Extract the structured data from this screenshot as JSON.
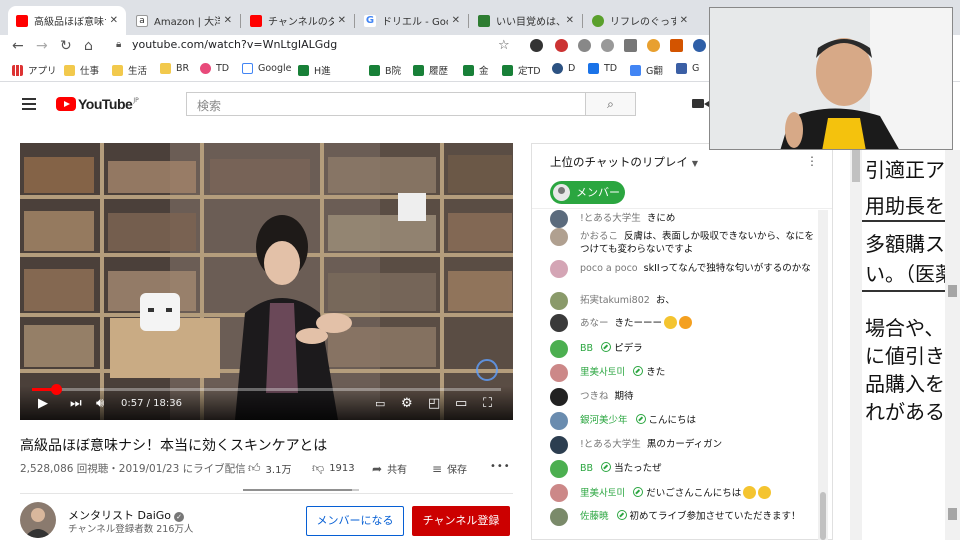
{
  "browser": {
    "tabs": [
      {
        "title": "高級品ほぼ意味ナシ",
        "favicon": "youtube-icon",
        "color": "#ff0000",
        "active": true
      },
      {
        "title": "Amazon | 大洋製",
        "favicon": "amazon-icon",
        "color": "#222222"
      },
      {
        "title": "チャンネルのダッシュ",
        "favicon": "youtube-icon",
        "color": "#ff0000"
      },
      {
        "title": "ドリエル - Google",
        "favicon": "google-icon",
        "color": "#4285f4"
      },
      {
        "title": "いい目覚めは、いい",
        "favicon": "site-icon",
        "color": "#2e7d32"
      },
      {
        "title": "リフレのぐっすりずむ",
        "favicon": "leaf-icon",
        "color": "#5aa02c"
      }
    ],
    "url": "youtube.com/watch?v=WnLtgIALGdg",
    "bookmarks": [
      "アプリ",
      "仕事",
      "生活",
      "BR",
      "TD",
      "Google",
      "H進",
      "B院",
      "履歴",
      "金",
      "定TD",
      "D",
      "TD",
      "G翻",
      "G"
    ]
  },
  "youtube": {
    "logo_text": "YouTube",
    "logo_region": "JP",
    "search_placeholder": "検索",
    "video": {
      "title": "高級品ほぼ意味ナシ！本当に効くスキンケアとは",
      "views": "2,528,086 回視聴・2019/01/23 にライブ配信",
      "likes": "3.1万",
      "dislikes": "1913",
      "like_ratio": 0.94,
      "share_label": "共有",
      "save_label": "保存",
      "more_label": "•••",
      "time": "0:57 / 18:36",
      "progress": 0.051
    },
    "channel": {
      "name": "メンタリスト DaiGo",
      "subscribers": "チャンネル登録者数 216万人",
      "member_button": "メンバーになる",
      "subscribe_button": "チャンネル登録"
    }
  },
  "chat": {
    "header": "上位のチャットのリプレイ",
    "chip_label": "メンバー",
    "messages": [
      {
        "author": "!とある大学生",
        "text": "きにめ",
        "member": false,
        "avatar": "#5b6b7d"
      },
      {
        "author": "かおるこ",
        "text": "反膚は、表面しか吸収できないから、なにをつけても変わらないですよ",
        "member": false,
        "avatar": "#b0a090"
      },
      {
        "author": "poco a poco",
        "text": "skIIってなんで独特な匂いがするのかな",
        "member": false,
        "avatar": "#d4a5b5"
      },
      {
        "author": "拓実takumi802",
        "text": "お、",
        "member": false,
        "avatar": "#8a9a6a"
      },
      {
        "author": "あなー",
        "text": "きたーーー",
        "member": false,
        "avatar": "#3a3a3a",
        "emoji": [
          "#f4c430",
          "#f4a020"
        ]
      },
      {
        "author": "BB",
        "text": "ピデラ",
        "member": true,
        "avatar": "#4caf50"
      },
      {
        "author": "里美사토미",
        "text": "きた",
        "member": true,
        "avatar": "#c88"
      },
      {
        "author": "つきね",
        "text": "期待",
        "member": false,
        "avatar": "#222"
      },
      {
        "author": "銀河美少年",
        "text": "こんにちは",
        "member": true,
        "avatar": "#6a8caf"
      },
      {
        "author": "!とある大学生",
        "text": "黒のカーディガン",
        "member": false,
        "avatar": "#2c3e50"
      },
      {
        "author": "BB",
        "text": "当たったぜ",
        "member": true,
        "avatar": "#4caf50"
      },
      {
        "author": "里美사토미",
        "text": "だいごさんこんにちは",
        "member": true,
        "avatar": "#c88",
        "emoji": [
          "#f4c430",
          "#f4c430"
        ]
      },
      {
        "author": "佐藤暁",
        "text": "初めてライブ参加させていただきます！",
        "member": true,
        "avatar": "#7a8a6a"
      }
    ]
  },
  "doc": {
    "lines": [
      "引適正ア",
      "用助長を",
      "多額購ス",
      "い。（医薬",
      "場合や、",
      "に値引き",
      "品購入を助",
      "れがある"
    ]
  }
}
